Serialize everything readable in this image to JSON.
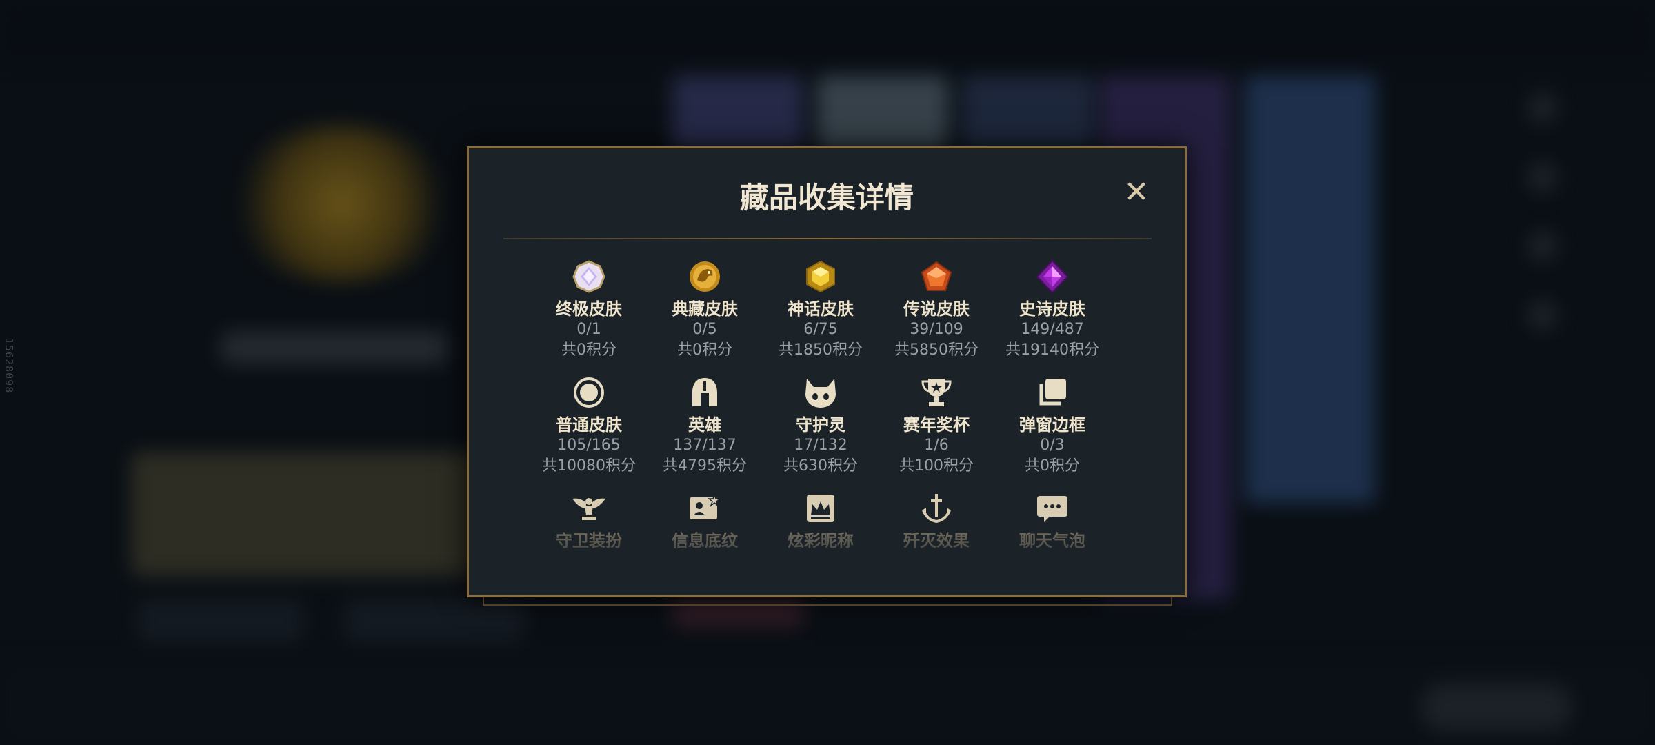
{
  "side_id": "15628098",
  "dialog": {
    "title": "藏品收集详情",
    "close_icon": "close-icon"
  },
  "rows": [
    [
      {
        "icon": "ultimate-gem-icon",
        "name": "终极皮肤",
        "count": "0/1",
        "points": "共0积分"
      },
      {
        "icon": "dragon-coin-icon",
        "name": "典藏皮肤",
        "count": "0/5",
        "points": "共0积分"
      },
      {
        "icon": "mythic-gem-icon",
        "name": "神话皮肤",
        "count": "6/75",
        "points": "共1850积分"
      },
      {
        "icon": "legendary-gem-icon",
        "name": "传说皮肤",
        "count": "39/109",
        "points": "共5850积分"
      },
      {
        "icon": "epic-gem-icon",
        "name": "史诗皮肤",
        "count": "149/487",
        "points": "共19140积分"
      }
    ],
    [
      {
        "icon": "ring-icon",
        "name": "普通皮肤",
        "count": "105/165",
        "points": "共10080积分"
      },
      {
        "icon": "helmet-icon",
        "name": "英雄",
        "count": "137/137",
        "points": "共4795积分"
      },
      {
        "icon": "guardian-face-icon",
        "name": "守护灵",
        "count": "17/132",
        "points": "共630积分"
      },
      {
        "icon": "trophy-icon",
        "name": "赛年奖杯",
        "count": "1/6",
        "points": "共100积分"
      },
      {
        "icon": "frames-icon",
        "name": "弹窗边框",
        "count": "0/3",
        "points": "共0积分"
      }
    ],
    [
      {
        "icon": "winged-guardian-icon",
        "name": "守卫装扮"
      },
      {
        "icon": "id-card-icon",
        "name": "信息底纹"
      },
      {
        "icon": "crown-card-icon",
        "name": "炫彩昵称"
      },
      {
        "icon": "anchor-sword-icon",
        "name": "歼灭效果"
      },
      {
        "icon": "chat-bubble-icon",
        "name": "聊天气泡"
      }
    ]
  ],
  "colors": {
    "gold_border": "#8a6d3b",
    "dialog_bg": "#1b2329",
    "title": "#f0e6d2",
    "muted": "#9aa0a6"
  }
}
